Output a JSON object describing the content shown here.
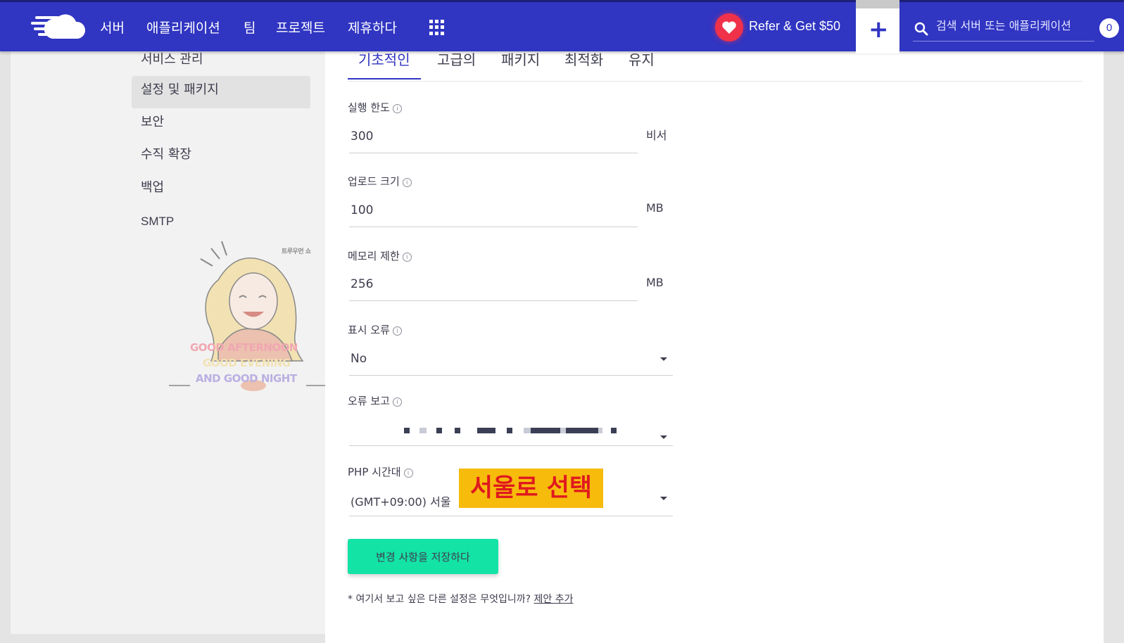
{
  "topbar": {
    "logo_icon": "cloudways-cloud-logo",
    "nav": [
      "서버",
      "애플리케이션",
      "팀",
      "프로젝트",
      "제휴하다"
    ],
    "apps_icon": "grid-icon",
    "refer_label": "Refer & Get $50",
    "plus_label": "+",
    "search_placeholder": "검색 서버 또는 애플리케이션",
    "notification_count": "0",
    "bg_color": "#3035c2"
  },
  "sidebar": {
    "items": [
      "서비스 관리",
      "설정 및 패키지",
      "보안",
      "수직 확장",
      "백업",
      "SMTP"
    ],
    "active_index": 1
  },
  "watermark": {
    "brand": "트루우먼 쇼",
    "line1": "GOOD AFTERNOON",
    "line2": "GOOD EVENING",
    "line3": "AND GOOD NIGHT"
  },
  "tabs": [
    "기초적인",
    "고급의",
    "패키지",
    "최적화",
    "유지"
  ],
  "form": {
    "execution_limit": {
      "label": "실행 한도",
      "value": "300",
      "unit": "비서"
    },
    "upload_size": {
      "label": "업로드 크기",
      "value": "100",
      "unit": "MB"
    },
    "memory_limit": {
      "label": "메모리 제한",
      "value": "256",
      "unit": "MB"
    },
    "display_errors": {
      "label": "표시 오류",
      "value": "No"
    },
    "error_reporting": {
      "label": "오류 보고"
    },
    "php_timezone": {
      "label": "PHP 시간대",
      "value": "(GMT+09:00) 서울"
    }
  },
  "annotation": {
    "text": "서울로 선택",
    "bg_color": "#f7bb0c",
    "text_color": "#e0191e"
  },
  "save_button": {
    "label": "변경 사항을 저장하다",
    "color": "#14e3a6"
  },
  "footnote": {
    "text": "* 여기서 보고 싶은 다른 설정은 무엇입니까? ",
    "link": "제안 추가"
  }
}
